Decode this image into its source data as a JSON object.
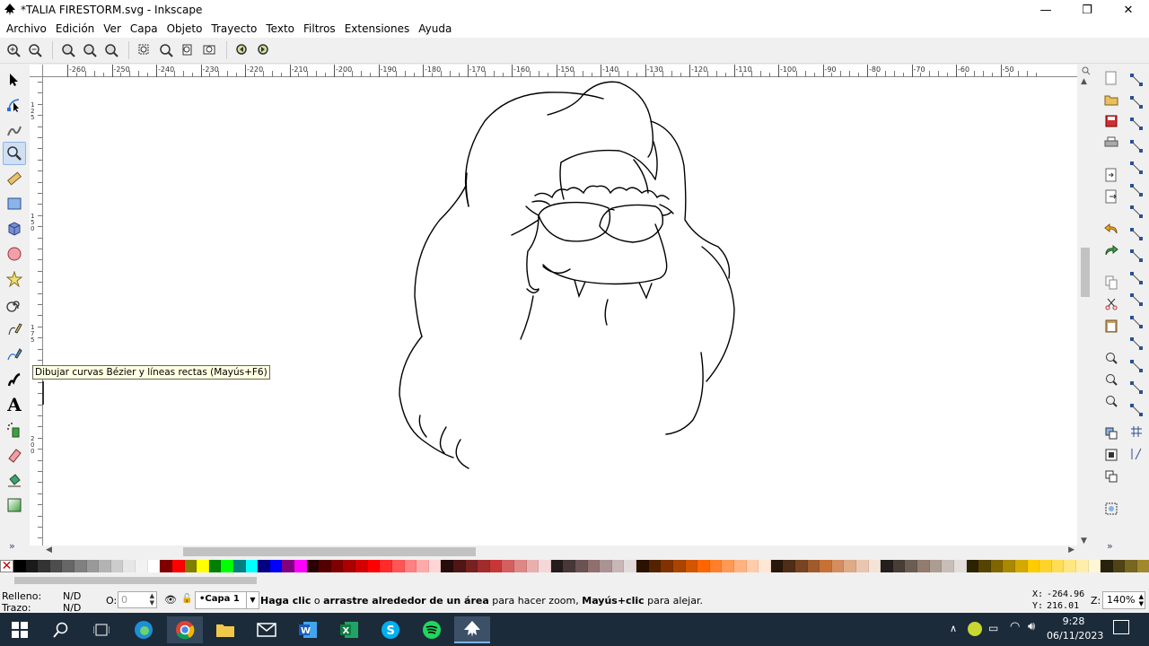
{
  "window": {
    "title": "*TALIA FIRESTORM.svg - Inkscape",
    "controls": [
      "—",
      "❐",
      "✕"
    ]
  },
  "menu": [
    "Archivo",
    "Edición",
    "Ver",
    "Capa",
    "Objeto",
    "Trayecto",
    "Texto",
    "Filtros",
    "Extensiones",
    "Ayuda"
  ],
  "tools": [
    "selector-tool",
    "node-tool",
    "tweak-tool",
    "zoom-tool",
    "measure-tool",
    "rect-tool",
    "3dbox-tool",
    "ellipse-tool",
    "star-tool",
    "spiral-tool",
    "pencil-tool",
    "pen-tool",
    "calligraphy-tool",
    "text-tool",
    "spray-tool",
    "eraser-tool",
    "bucket-tool",
    "gradient-tool"
  ],
  "tooltip": "Dibujar curvas Bézier y líneas rectas (Mayús+F6)",
  "ruler": {
    "h_labels": [
      "-260",
      "-250",
      "-240",
      "-230",
      "-220",
      "-210",
      "-200",
      "-190",
      "-180",
      "-170",
      "-160",
      "-150",
      "-140",
      "-130",
      "-120",
      "-110",
      "-100",
      "-90",
      "-80",
      "-70",
      "-60",
      "-50"
    ],
    "v_labels": [
      "125",
      "150",
      "175",
      "200"
    ]
  },
  "palette": [
    "#000000",
    "#1a1a1a",
    "#333333",
    "#4d4d4d",
    "#666666",
    "#808080",
    "#999999",
    "#b3b3b3",
    "#cccccc",
    "#e6e6e6",
    "#f2f2f2",
    "#ffffff",
    "#800000",
    "#ff0000",
    "#808000",
    "#ffff00",
    "#008000",
    "#00ff00",
    "#008080",
    "#00ffff",
    "#000080",
    "#0000ff",
    "#800080",
    "#ff00ff",
    "#2b0000",
    "#550000",
    "#800000",
    "#aa0000",
    "#d40000",
    "#ff0000",
    "#ff2a2a",
    "#ff5555",
    "#ff8080",
    "#ffaaaa",
    "#ffd5d5",
    "#280b0b",
    "#501616",
    "#782121",
    "#a02c2c",
    "#c83737",
    "#d35f5f",
    "#de8787",
    "#e9afaf",
    "#f4d7d7",
    "#241c1c",
    "#483737",
    "#6c5353",
    "#916f6f",
    "#ac9393",
    "#c8b7b7",
    "#e3dbdb",
    "#2b1100",
    "#552200",
    "#803300",
    "#aa4400",
    "#d45500",
    "#ff6600",
    "#ff7f2a",
    "#ff9955",
    "#ffb380",
    "#ffccaa",
    "#ffe6d5",
    "#28170b",
    "#502d16",
    "#784421",
    "#a05a2c",
    "#c87137",
    "#d38d5f",
    "#deaa87",
    "#e9c6af",
    "#f4e3d7",
    "#241f1c",
    "#483e37",
    "#6c5d53",
    "#917c6f",
    "#ac9d93",
    "#c8beb7",
    "#e3dedb",
    "#2b2200",
    "#554400",
    "#806600",
    "#aa8800",
    "#d4aa00",
    "#ffcc00",
    "#ffd42a",
    "#ffdd55",
    "#ffe680",
    "#ffeeaa",
    "#fff6d5",
    "#28220b",
    "#504416",
    "#786721",
    "#a0892c"
  ],
  "status": {
    "fill_label": "Relleno:",
    "fill_value": "N/D",
    "stroke_label": "Trazo:",
    "stroke_value": "N/D",
    "opacity_label": "O:",
    "opacity_value": "0",
    "layer": "•Capa 1",
    "message_bold1": "Haga clic",
    "message_plain1": " o ",
    "message_bold2": "arrastre alrededor de un área",
    "message_plain2": " para hacer zoom, ",
    "message_bold3": "Mayús+clic",
    "message_plain3": " para alejar.",
    "x_label": "X:",
    "x_value": "-264.96",
    "y_label": "Y:",
    "y_value": "216.01",
    "zoom_label": "Z:",
    "zoom_value": "140%"
  },
  "taskbar": {
    "apps": [
      "windows-start",
      "search",
      "task-view",
      "edge",
      "chrome",
      "explorer",
      "mail",
      "word",
      "excel",
      "skype",
      "spotify",
      "inkscape"
    ],
    "time": "9:28",
    "date": "06/11/2023"
  }
}
